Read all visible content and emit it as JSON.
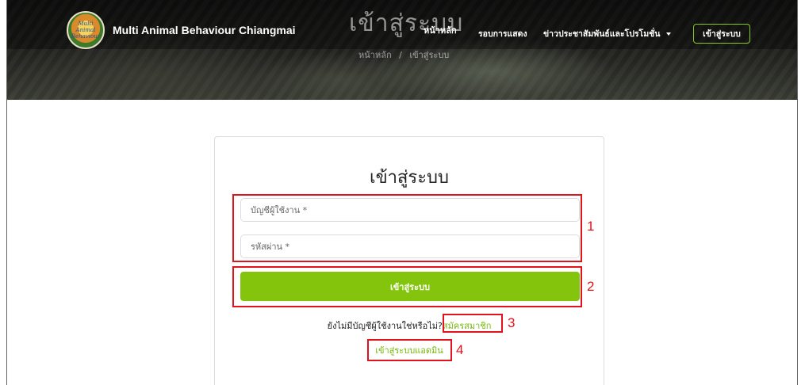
{
  "header": {
    "brand_name": "Multi Animal Behaviour Chiangmai",
    "logo_text": "Multi Animal Behaviour",
    "page_heading": "เข้าสู่ระบบ",
    "nav": {
      "home": "หน้าหลัก",
      "shows": "รอบการแสดง",
      "news": "ข่าวประชาสัมพันธ์และโปรโมชั่น",
      "login_button": "เข้าสู่ระบบ"
    },
    "breadcrumb": {
      "home": "หน้าหลัก",
      "separator": "/",
      "current": "เข้าสู่ระบบ"
    }
  },
  "login_form": {
    "title": "เข้าสู่ระบบ",
    "username_placeholder": "บัญชีผู้ใช้งาน *",
    "password_placeholder": "รหัสผ่าน *",
    "submit_label": "เข้าสู่ระบบ",
    "no_account_text": "ยังไม่มีบัญชีผู้ใช้งานใช่หรือไม่?",
    "signup_link": "สมัครสมาชิก",
    "admin_link": "เข้าสู่ระบบแอดมิน"
  },
  "annotations": {
    "label_1": "1",
    "label_2": "2",
    "label_3": "3",
    "label_4": "4"
  },
  "colors": {
    "accent_green": "#84c40d",
    "link_green": "#79b70c",
    "annotation_red": "#e3131c"
  }
}
